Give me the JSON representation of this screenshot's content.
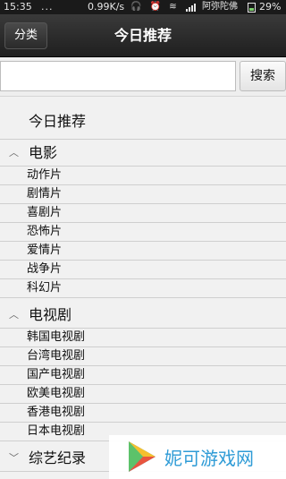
{
  "status_bar": {
    "time": "15:35",
    "dots": "...",
    "speed": "0.99K/s",
    "icons": "🎧 ⏰ ≋",
    "carrier": "阿弥陀佛",
    "battery": "29%"
  },
  "title_bar": {
    "category_button": "分类",
    "title": "今日推荐"
  },
  "search": {
    "input_value": "",
    "button": "搜索"
  },
  "today_item": "今日推荐",
  "groups": [
    {
      "label": "电影",
      "items": [
        "动作片",
        "剧情片",
        "喜剧片",
        "恐怖片",
        "爱情片",
        "战争片",
        "科幻片"
      ]
    },
    {
      "label": "电视剧",
      "items": [
        "韩国电视剧",
        "台湾电视剧",
        "国产电视剧",
        "欧美电视剧",
        "香港电视剧",
        "日本电视剧"
      ]
    },
    {
      "label": "综艺纪录",
      "items": []
    }
  ],
  "watermark": {
    "text": "妮可游戏网"
  },
  "colors": {
    "title_bar": "#2b2b2b",
    "accent_blue": "#2e9bd6",
    "background": "#f1f1f1"
  }
}
